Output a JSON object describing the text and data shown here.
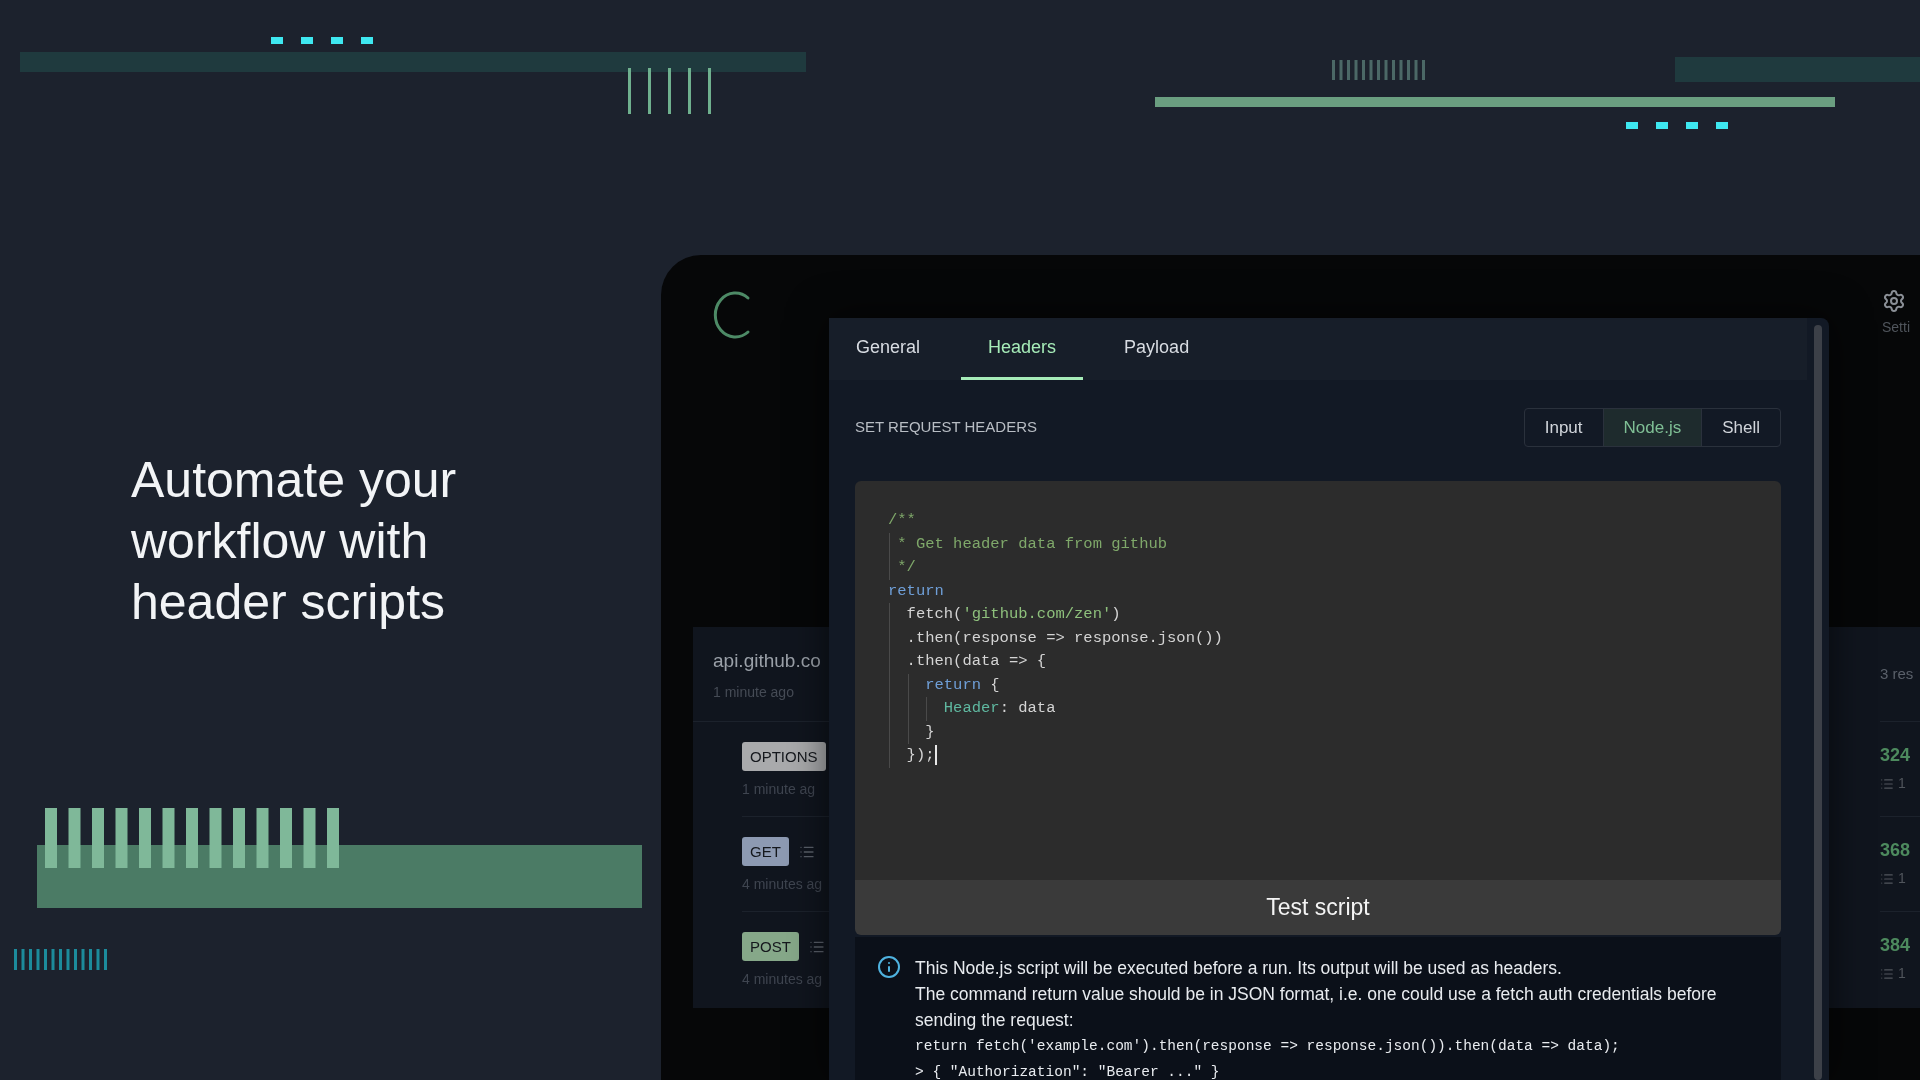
{
  "hero": {
    "heading": "Automate your workflow with header scripts"
  },
  "app": {
    "settings_label": "Setti",
    "history": {
      "title": "api.github.co",
      "time": "1 minute ago",
      "count": "3 res",
      "rows": [
        {
          "method": "OPTIONS",
          "color": "#a9aaac",
          "time": "1 minute ag",
          "size": "324",
          "detail": "1",
          "has_menu": false
        },
        {
          "method": "GET",
          "color": "#8d9ab2",
          "time": "4 minutes ag",
          "size": "368",
          "detail": "1",
          "has_menu": true
        },
        {
          "method": "POST",
          "color": "#86a889",
          "time": "4 minutes ag",
          "size": "384",
          "detail": "1",
          "has_menu": true
        }
      ]
    }
  },
  "modal": {
    "tabs": [
      {
        "label": "General",
        "selected": false
      },
      {
        "label": "Headers",
        "selected": true
      },
      {
        "label": "Payload",
        "selected": false
      }
    ],
    "section_title": "SET REQUEST HEADERS",
    "modes": [
      {
        "label": "Input",
        "selected": false
      },
      {
        "label": "Node.js",
        "selected": true
      },
      {
        "label": "Shell",
        "selected": false
      }
    ],
    "code": [
      {
        "tokens": [
          {
            "kind": "comment",
            "text": "/**"
          }
        ]
      },
      {
        "tokens": [
          {
            "kind": "comment",
            "text": " * Get header data from github"
          }
        ]
      },
      {
        "tokens": [
          {
            "kind": "comment",
            "text": " */"
          }
        ]
      },
      {
        "tokens": [
          {
            "kind": "keyword",
            "text": "return"
          }
        ]
      },
      {
        "tokens": [
          {
            "kind": "plain",
            "text": "  fetch("
          },
          {
            "kind": "string",
            "text": "'github.com/zen'"
          },
          {
            "kind": "plain",
            "text": ")"
          }
        ]
      },
      {
        "tokens": [
          {
            "kind": "plain",
            "text": "  .then(response => response.json())"
          }
        ]
      },
      {
        "tokens": [
          {
            "kind": "plain",
            "text": "  .then(data => {"
          }
        ]
      },
      {
        "tokens": [
          {
            "kind": "keyword",
            "text": "    return"
          },
          {
            "kind": "plain",
            "text": " {"
          }
        ]
      },
      {
        "tokens": [
          {
            "kind": "property",
            "text": "      Header"
          },
          {
            "kind": "plain",
            "text": ": data"
          }
        ]
      },
      {
        "tokens": [
          {
            "kind": "plain",
            "text": "    }"
          }
        ]
      },
      {
        "tokens": [
          {
            "kind": "plain",
            "text": "  });"
          }
        ],
        "cursor": true
      }
    ],
    "test_button": "Test script",
    "info": {
      "lines": [
        "This Node.js script will be executed before a run. Its output will be used as headers.",
        "The command return value should be in JSON format, i.e. one could use a fetch auth credentials before sending the request:"
      ],
      "examples": [
        "return fetch('example.com').then(response => response.json()).then(data => data);",
        "> { \"Authorization\": \"Bearer ...\" }"
      ]
    }
  }
}
